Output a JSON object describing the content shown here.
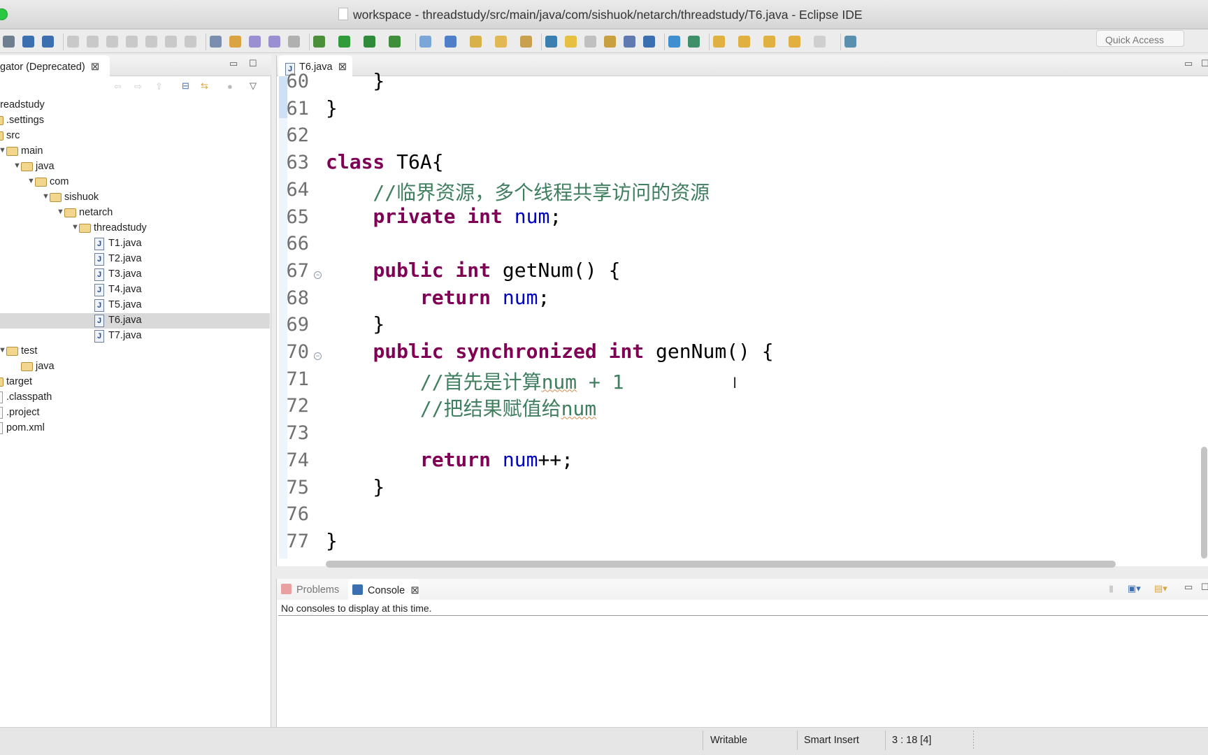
{
  "window": {
    "title": "workspace - threadstudy/src/main/java/com/sishuok/netarch/threadstudy/T6.java - Eclipse IDE"
  },
  "toolbar": {
    "quick_access_placeholder": "Quick Access",
    "icons": [
      "save-all-icon",
      "terminal-icon",
      "skip-breakpoints-icon",
      "resume-icon",
      "suspend-icon",
      "terminate-icon",
      "disconnect-icon",
      "step-into-icon",
      "step-over-icon",
      "step-return-icon",
      "open-task-icon",
      "toggle-mark-icon",
      "prev-annotation-icon",
      "next-annotation-icon",
      "remove-breakpoints-icon",
      "debug-icon",
      "run-icon",
      "coverage-icon",
      "external-tools-icon",
      "new-java-project-icon",
      "new-class-icon",
      "open-type-icon",
      "open-task-folder-icon",
      "pen-icon",
      "search-icon",
      "highlight-icon",
      "toggle-block-icon",
      "word-wrap-icon",
      "show-whitespace-icon",
      "pilcrow-icon",
      "globe-icon",
      "java-run-icon",
      "next-edit-icon",
      "prev-edit-icon",
      "last-edit-icon",
      "back-icon",
      "forward-icon",
      "open-perspective-icon"
    ],
    "colors": [
      "#6f7f90",
      "#3b6fb0",
      "#3b6fb0",
      "#c9c9c9",
      "#c9c9c9",
      "#c9c9c9",
      "#c9c9c9",
      "#c9c9c9",
      "#c9c9c9",
      "#c9c9c9",
      "#7a8fb0",
      "#d9a441",
      "#9a8fd0",
      "#9a8fd0",
      "#b0b0b0",
      "#4b8f3b",
      "#2f9b3a",
      "#2f8b3a",
      "#3f8f3a",
      "#7aa7d8",
      "#4f7fc8",
      "#d8b14a",
      "#e2b854",
      "#c8a050",
      "#3b7fb0",
      "#e6c040",
      "#c0c0c0",
      "#c9a040",
      "#5e7ab0",
      "#3b6fb0",
      "#3f8fd0",
      "#3f8f6a",
      "#e0b040",
      "#e0b040",
      "#e0b040",
      "#e2b040",
      "#cfcfcf",
      "#5a8fb0"
    ]
  },
  "navigator": {
    "tab_label": "gator (Deprecated)",
    "tree": [
      {
        "label": "threadstudy",
        "level": 0,
        "type": "project",
        "expanded": true
      },
      {
        "label": ".settings",
        "level": 1,
        "type": "folder",
        "expanded": false
      },
      {
        "label": "src",
        "level": 1,
        "type": "folder",
        "expanded": true
      },
      {
        "label": "main",
        "level": 2,
        "type": "folder",
        "expanded": true
      },
      {
        "label": "java",
        "level": 3,
        "type": "folder",
        "expanded": true
      },
      {
        "label": "com",
        "level": 4,
        "type": "folder",
        "expanded": true
      },
      {
        "label": "sishuok",
        "level": 5,
        "type": "folder",
        "expanded": true
      },
      {
        "label": "netarch",
        "level": 6,
        "type": "folder",
        "expanded": true
      },
      {
        "label": "threadstudy",
        "level": 7,
        "type": "folder",
        "expanded": true
      },
      {
        "label": "T1.java",
        "level": 8,
        "type": "java"
      },
      {
        "label": "T2.java",
        "level": 8,
        "type": "java"
      },
      {
        "label": "T3.java",
        "level": 8,
        "type": "java"
      },
      {
        "label": "T4.java",
        "level": 8,
        "type": "java"
      },
      {
        "label": "T5.java",
        "level": 8,
        "type": "java"
      },
      {
        "label": "T6.java",
        "level": 8,
        "type": "java",
        "selected": true
      },
      {
        "label": "T7.java",
        "level": 8,
        "type": "java"
      },
      {
        "label": "test",
        "level": 2,
        "type": "folder",
        "expanded": true
      },
      {
        "label": "java",
        "level": 3,
        "type": "folder"
      },
      {
        "label": "target",
        "level": 1,
        "type": "folder",
        "expanded": false
      },
      {
        "label": ".classpath",
        "level": 1,
        "type": "file"
      },
      {
        "label": ".project",
        "level": 1,
        "type": "file"
      },
      {
        "label": "pom.xml",
        "level": 1,
        "type": "file"
      }
    ]
  },
  "editor": {
    "tab_label": "T6.java",
    "tab_icon": "J",
    "lines": [
      {
        "n": "60",
        "tokens": [
          [
            "p",
            "    }"
          ]
        ]
      },
      {
        "n": "61",
        "tokens": [
          [
            "p",
            "}"
          ]
        ]
      },
      {
        "n": "62",
        "tokens": []
      },
      {
        "n": "63",
        "tokens": [
          [
            "kw",
            "class"
          ],
          [
            "p",
            " T6A{"
          ]
        ]
      },
      {
        "n": "64",
        "tokens": [
          [
            "cm",
            "    //临界资源，多个线程共享访问的资源"
          ]
        ]
      },
      {
        "n": "65",
        "tokens": [
          [
            "p",
            "    "
          ],
          [
            "kw",
            "private int"
          ],
          [
            "p",
            " "
          ],
          [
            "fld",
            "num"
          ],
          [
            "p",
            ";"
          ]
        ]
      },
      {
        "n": "66",
        "tokens": []
      },
      {
        "n": "67",
        "fold": true,
        "tokens": [
          [
            "p",
            "    "
          ],
          [
            "kw",
            "public int"
          ],
          [
            "p",
            " getNum() {"
          ]
        ]
      },
      {
        "n": "68",
        "tokens": [
          [
            "p",
            "        "
          ],
          [
            "kw",
            "return"
          ],
          [
            "p",
            " "
          ],
          [
            "fld",
            "num"
          ],
          [
            "p",
            ";"
          ]
        ]
      },
      {
        "n": "69",
        "tokens": [
          [
            "p",
            "    }"
          ]
        ]
      },
      {
        "n": "70",
        "fold": true,
        "tokens": [
          [
            "p",
            "    "
          ],
          [
            "kw",
            "public synchronized int"
          ],
          [
            "p",
            " genNum() {"
          ]
        ]
      },
      {
        "n": "71",
        "tokens": [
          [
            "cm",
            "        //首先是计算"
          ],
          [
            "cmsq",
            "num"
          ],
          [
            "cm",
            " + 1"
          ]
        ]
      },
      {
        "n": "72",
        "tokens": [
          [
            "cm",
            "        //把结果赋值给"
          ],
          [
            "cmsq",
            "num"
          ]
        ]
      },
      {
        "n": "73",
        "tokens": []
      },
      {
        "n": "74",
        "tokens": [
          [
            "p",
            "        "
          ],
          [
            "kw",
            "return"
          ],
          [
            "p",
            " "
          ],
          [
            "fld",
            "num"
          ],
          [
            "p",
            "++;"
          ]
        ]
      },
      {
        "n": "75",
        "tokens": [
          [
            "p",
            "    }"
          ]
        ]
      },
      {
        "n": "76",
        "tokens": []
      },
      {
        "n": "77",
        "tokens": [
          [
            "p",
            "}"
          ]
        ]
      }
    ]
  },
  "bottom": {
    "tabs": [
      {
        "label": "Problems",
        "active": false
      },
      {
        "label": "Console",
        "active": true
      }
    ],
    "console_message": "No consoles to display at this time."
  },
  "status": {
    "writable": "Writable",
    "insert_mode": "Smart Insert",
    "position": "3 : 18 [4]"
  },
  "colors": {
    "keyword": "#7f0055",
    "field": "#0000c0",
    "comment": "#3f7f5f",
    "selection": "#d9d9d9"
  }
}
